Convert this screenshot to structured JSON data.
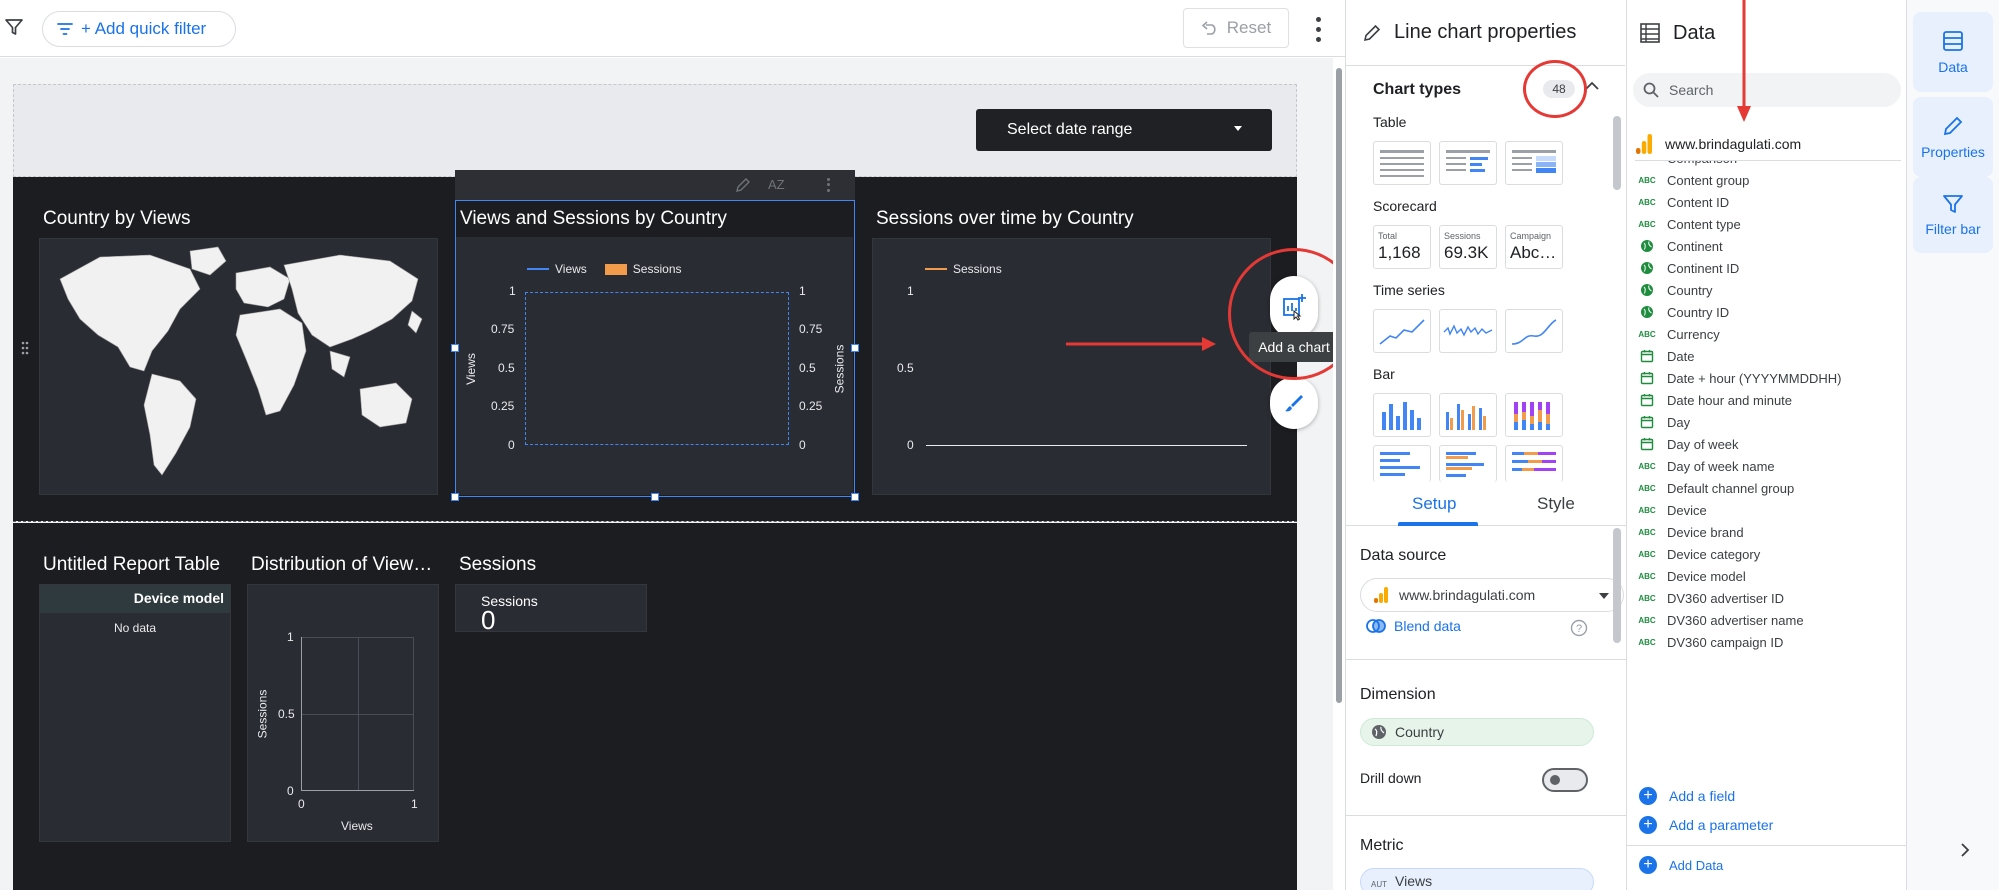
{
  "toolbar": {
    "add_filter_label": "+ Add quick filter",
    "reset_label": "Reset"
  },
  "canvas": {
    "date_range_label": "Select date range",
    "charts": {
      "map_title": "Country by Views",
      "combo_title": "Views and Sessions by Country",
      "combo_legend": [
        "Views",
        "Sessions"
      ],
      "combo_left_ticks": [
        "1",
        "0.75",
        "0.5",
        "0.25",
        "0"
      ],
      "combo_right_ticks": [
        "1",
        "0.75",
        "0.5",
        "0.25",
        "0"
      ],
      "combo_left_axis": "Views",
      "combo_right_axis": "Sessions",
      "line_title": "Sessions over time by Country",
      "line_legend": "Sessions",
      "line_ticks": [
        "1",
        "0.5",
        "0"
      ],
      "table_title": "Untitled Report Table",
      "table_header": "Device model",
      "table_empty": "No data",
      "scatter_title": "Distribution of View…",
      "scatter_y_ticks": [
        "1",
        "0.5",
        "0"
      ],
      "scatter_x_ticks": [
        "0",
        "1"
      ],
      "scatter_x_axis": "Views",
      "scatter_y_axis": "Sessions",
      "scorecard_title": "Sessions",
      "scorecard_label": "Sessions",
      "scorecard_value": "0"
    },
    "mini_toolbar_sort": "AZ",
    "tooltip": "Add a chart"
  },
  "properties": {
    "title": "Line chart properties",
    "chart_types_label": "Chart types",
    "chart_types_count": "48",
    "groups": {
      "table": "Table",
      "scorecard": "Scorecard",
      "time_series": "Time series",
      "bar": "Bar"
    },
    "scorecards": [
      {
        "label": "Total",
        "value": "1,168"
      },
      {
        "label": "Sessions",
        "value": "69.3K"
      },
      {
        "label": "Campaign",
        "value": "Abc…"
      }
    ],
    "tabs": [
      "Setup",
      "Style"
    ],
    "data_source_label": "Data source",
    "data_source_value": "www.brindagulati.com",
    "blend_label": "Blend data",
    "dimension_label": "Dimension",
    "dimension_value": "Country",
    "drill_down_label": "Drill down",
    "metric_label": "Metric",
    "metric_value": "Views",
    "metric_prefix": "AUT"
  },
  "data_panel": {
    "title": "Data",
    "search_placeholder": "Search",
    "source": "www.brindagulati.com",
    "fields": [
      {
        "name": "Comparison",
        "type": "text"
      },
      {
        "name": "Content group",
        "type": "text"
      },
      {
        "name": "Content ID",
        "type": "text"
      },
      {
        "name": "Content type",
        "type": "text"
      },
      {
        "name": "Continent",
        "type": "geo"
      },
      {
        "name": "Continent ID",
        "type": "geo"
      },
      {
        "name": "Country",
        "type": "geo"
      },
      {
        "name": "Country ID",
        "type": "geo"
      },
      {
        "name": "Currency",
        "type": "text"
      },
      {
        "name": "Date",
        "type": "date"
      },
      {
        "name": "Date + hour (YYYYMMDDHH)",
        "type": "date"
      },
      {
        "name": "Date hour and minute",
        "type": "date"
      },
      {
        "name": "Day",
        "type": "date"
      },
      {
        "name": "Day of week",
        "type": "date"
      },
      {
        "name": "Day of week name",
        "type": "text"
      },
      {
        "name": "Default channel group",
        "type": "text"
      },
      {
        "name": "Device",
        "type": "text"
      },
      {
        "name": "Device brand",
        "type": "text"
      },
      {
        "name": "Device category",
        "type": "text"
      },
      {
        "name": "Device model",
        "type": "text"
      },
      {
        "name": "DV360 advertiser ID",
        "type": "text"
      },
      {
        "name": "DV360 advertiser name",
        "type": "text"
      },
      {
        "name": "DV360 campaign ID",
        "type": "text"
      }
    ],
    "add_field": "Add a field",
    "add_parameter": "Add a parameter",
    "add_data": "Add Data"
  },
  "rail": {
    "data": "Data",
    "properties": "Properties",
    "filter_bar": "Filter bar"
  },
  "colors": {
    "accent": "#1a73e8",
    "selection": "#4285f4",
    "annotation": "#e53935",
    "canvas_dark": "#1c1d21",
    "series_views": "#4285f4",
    "series_sessions": "#f29b4b",
    "field_text": "#1e8e3e"
  },
  "icons": [
    "filter-icon",
    "undo-icon",
    "more-vert-icon",
    "pencil-icon",
    "chevron-up-icon",
    "add-chart-icon",
    "brush-icon",
    "table-icon",
    "search-icon",
    "analytics-icon",
    "globe-icon",
    "calendar-icon",
    "filter-bar-icon",
    "chevron-right-icon",
    "help-icon",
    "blend-icon"
  ]
}
